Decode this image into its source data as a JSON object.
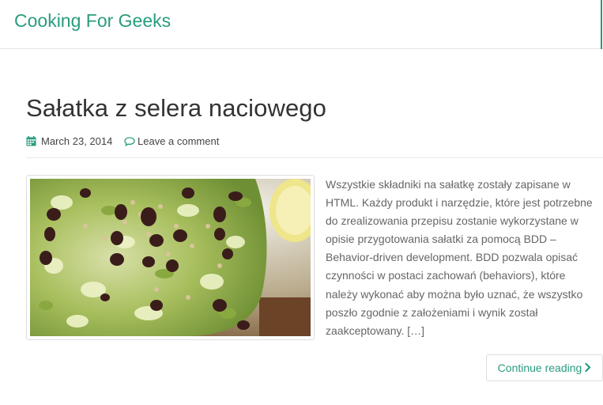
{
  "site": {
    "title": "Cooking For Geeks"
  },
  "post": {
    "title": "Sałatka z selera naciowego",
    "date": "March 23, 2014",
    "comment_link": "Leave a comment",
    "excerpt": "Wszystkie składniki na sałatkę zostały zapisane w HTML. Każdy produkt i narzędzie, które jest potrzebne do zrealizowania przepisu zostanie wykorzystane w opisie przygotowania sałatki za pomocą BDD – Behavior-driven development. BDD pozwala opisać czynności w postaci zachowań (behaviors), które należy wykonać aby można było uznać, że wszystko poszło zgodnie z założeniami i wynik został zaakceptowany. […]",
    "continue_label": "Continue reading"
  },
  "icons": {
    "date": "calendar-icon",
    "comment": "comment-icon",
    "continue": "chevron-right-icon"
  },
  "colors": {
    "accent": "#2a9c7e",
    "text": "#333333",
    "muted": "#666666"
  }
}
